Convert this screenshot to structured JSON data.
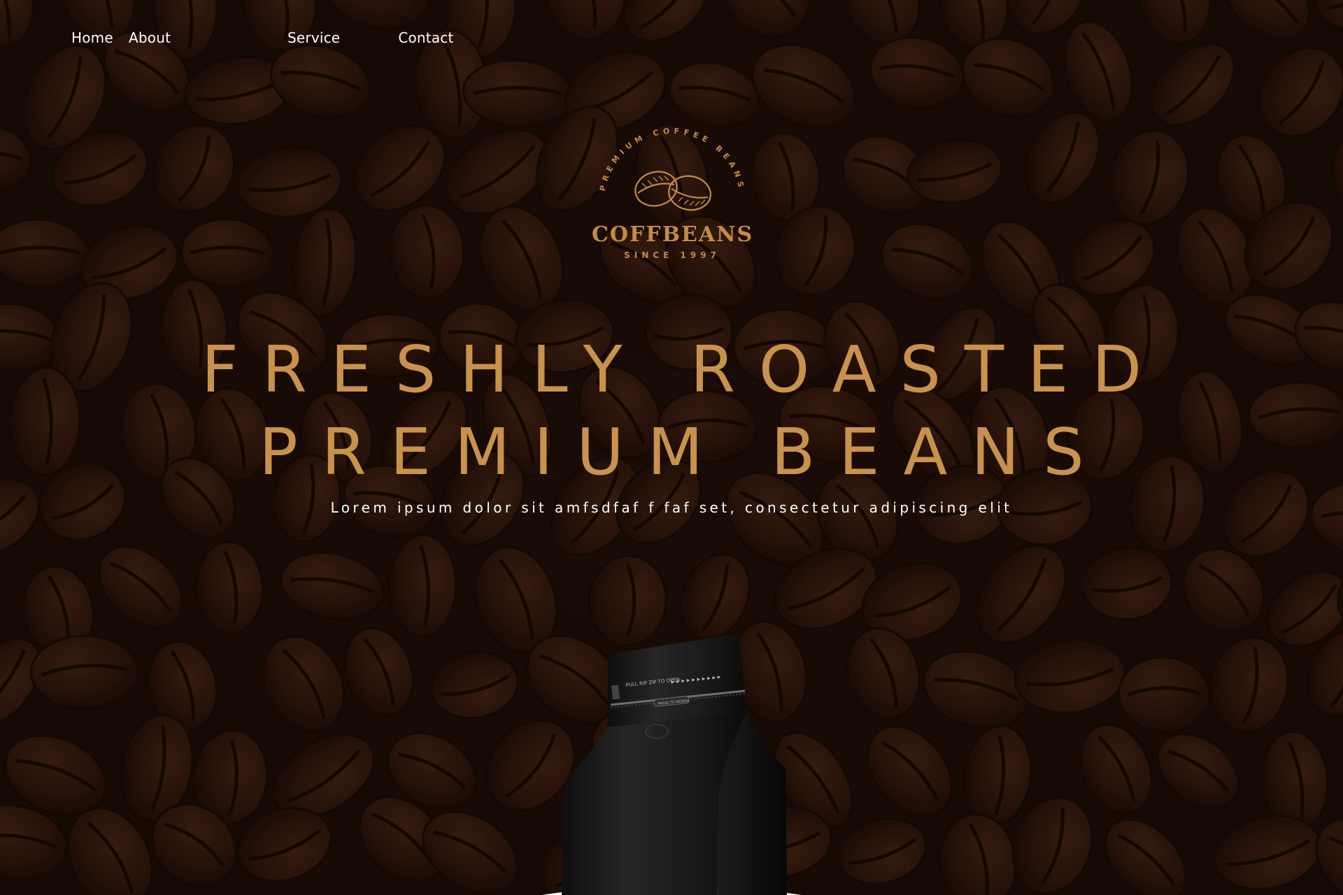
{
  "nav": {
    "items": [
      {
        "label": "Home"
      },
      {
        "label": "About"
      },
      {
        "label": "Service"
      },
      {
        "label": "Contact"
      }
    ]
  },
  "brand": {
    "arc_text": "PREMIUM COFFEE BEANS",
    "name": "COFFBEANS",
    "since": "SINCE 1997",
    "color": "#c48b45"
  },
  "hero": {
    "headline_line1": "FRESHLY ROASTED",
    "headline_line2": "PREMIUM BEANS",
    "subline": "Lorem ipsum dolor sit amfsdfaf f faf set, consectetur adipiscing elit",
    "headline_color": "#c9924c",
    "background_color": "#1e0f08"
  },
  "product": {
    "icon": "coffee-bag-icon",
    "bag_color": "#1a1a1a",
    "zip_text": "PULL RIP ZIP TO OPEN",
    "tag_text": "PRESS TO RESEAL"
  }
}
